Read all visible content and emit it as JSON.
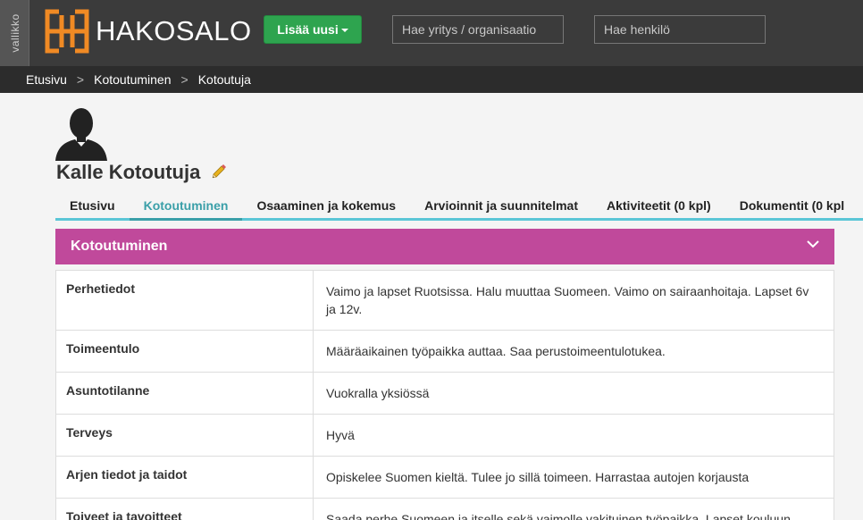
{
  "sidebar_toggle": {
    "label": "vallikko"
  },
  "brand": {
    "name": "HAKOSALO",
    "logo_color": "#f08a24"
  },
  "header": {
    "add_new_label": "Lisää uusi",
    "search_org_placeholder": "Hae yritys / organisaatio",
    "search_person_placeholder": "Hae henkilö"
  },
  "breadcrumb": {
    "items": [
      "Etusivu",
      "Kotoutuminen",
      "Kotoutuja"
    ],
    "separator": ">"
  },
  "profile": {
    "name": "Kalle Kotoutuja"
  },
  "tabs": [
    {
      "label": "Etusivu"
    },
    {
      "label": "Kotoutuminen",
      "active": true
    },
    {
      "label": "Osaaminen ja kokemus"
    },
    {
      "label": "Arvioinnit ja suunnitelmat"
    },
    {
      "label": "Aktiviteetit (0 kpl)"
    },
    {
      "label": "Dokumentit (0 kpl"
    }
  ],
  "panel": {
    "title": "Kotoutuminen",
    "accent_color": "#c0499b",
    "rows": [
      {
        "label": "Perhetiedot",
        "value": "Vaimo ja lapset Ruotsissa. Halu muuttaa Suomeen. Vaimo on sairaanhoitaja. Lapset 6v ja 12v."
      },
      {
        "label": "Toimeentulo",
        "value": "Määräaikainen työpaikka auttaa. Saa perustoimeentulotukea."
      },
      {
        "label": "Asuntotilanne",
        "value": "Vuokralla yksiössä"
      },
      {
        "label": "Terveys",
        "value": "Hyvä"
      },
      {
        "label": "Arjen tiedot ja taidot",
        "value": "Opiskelee Suomen kieltä. Tulee jo sillä toimeen. Harrastaa autojen korjausta"
      },
      {
        "label": "Toiveet ja tavoitteet",
        "value": "Saada perhe Suomeen ja itselle sekä vaimolle vakituinen työpaikka. Lapset kouluun."
      }
    ]
  }
}
